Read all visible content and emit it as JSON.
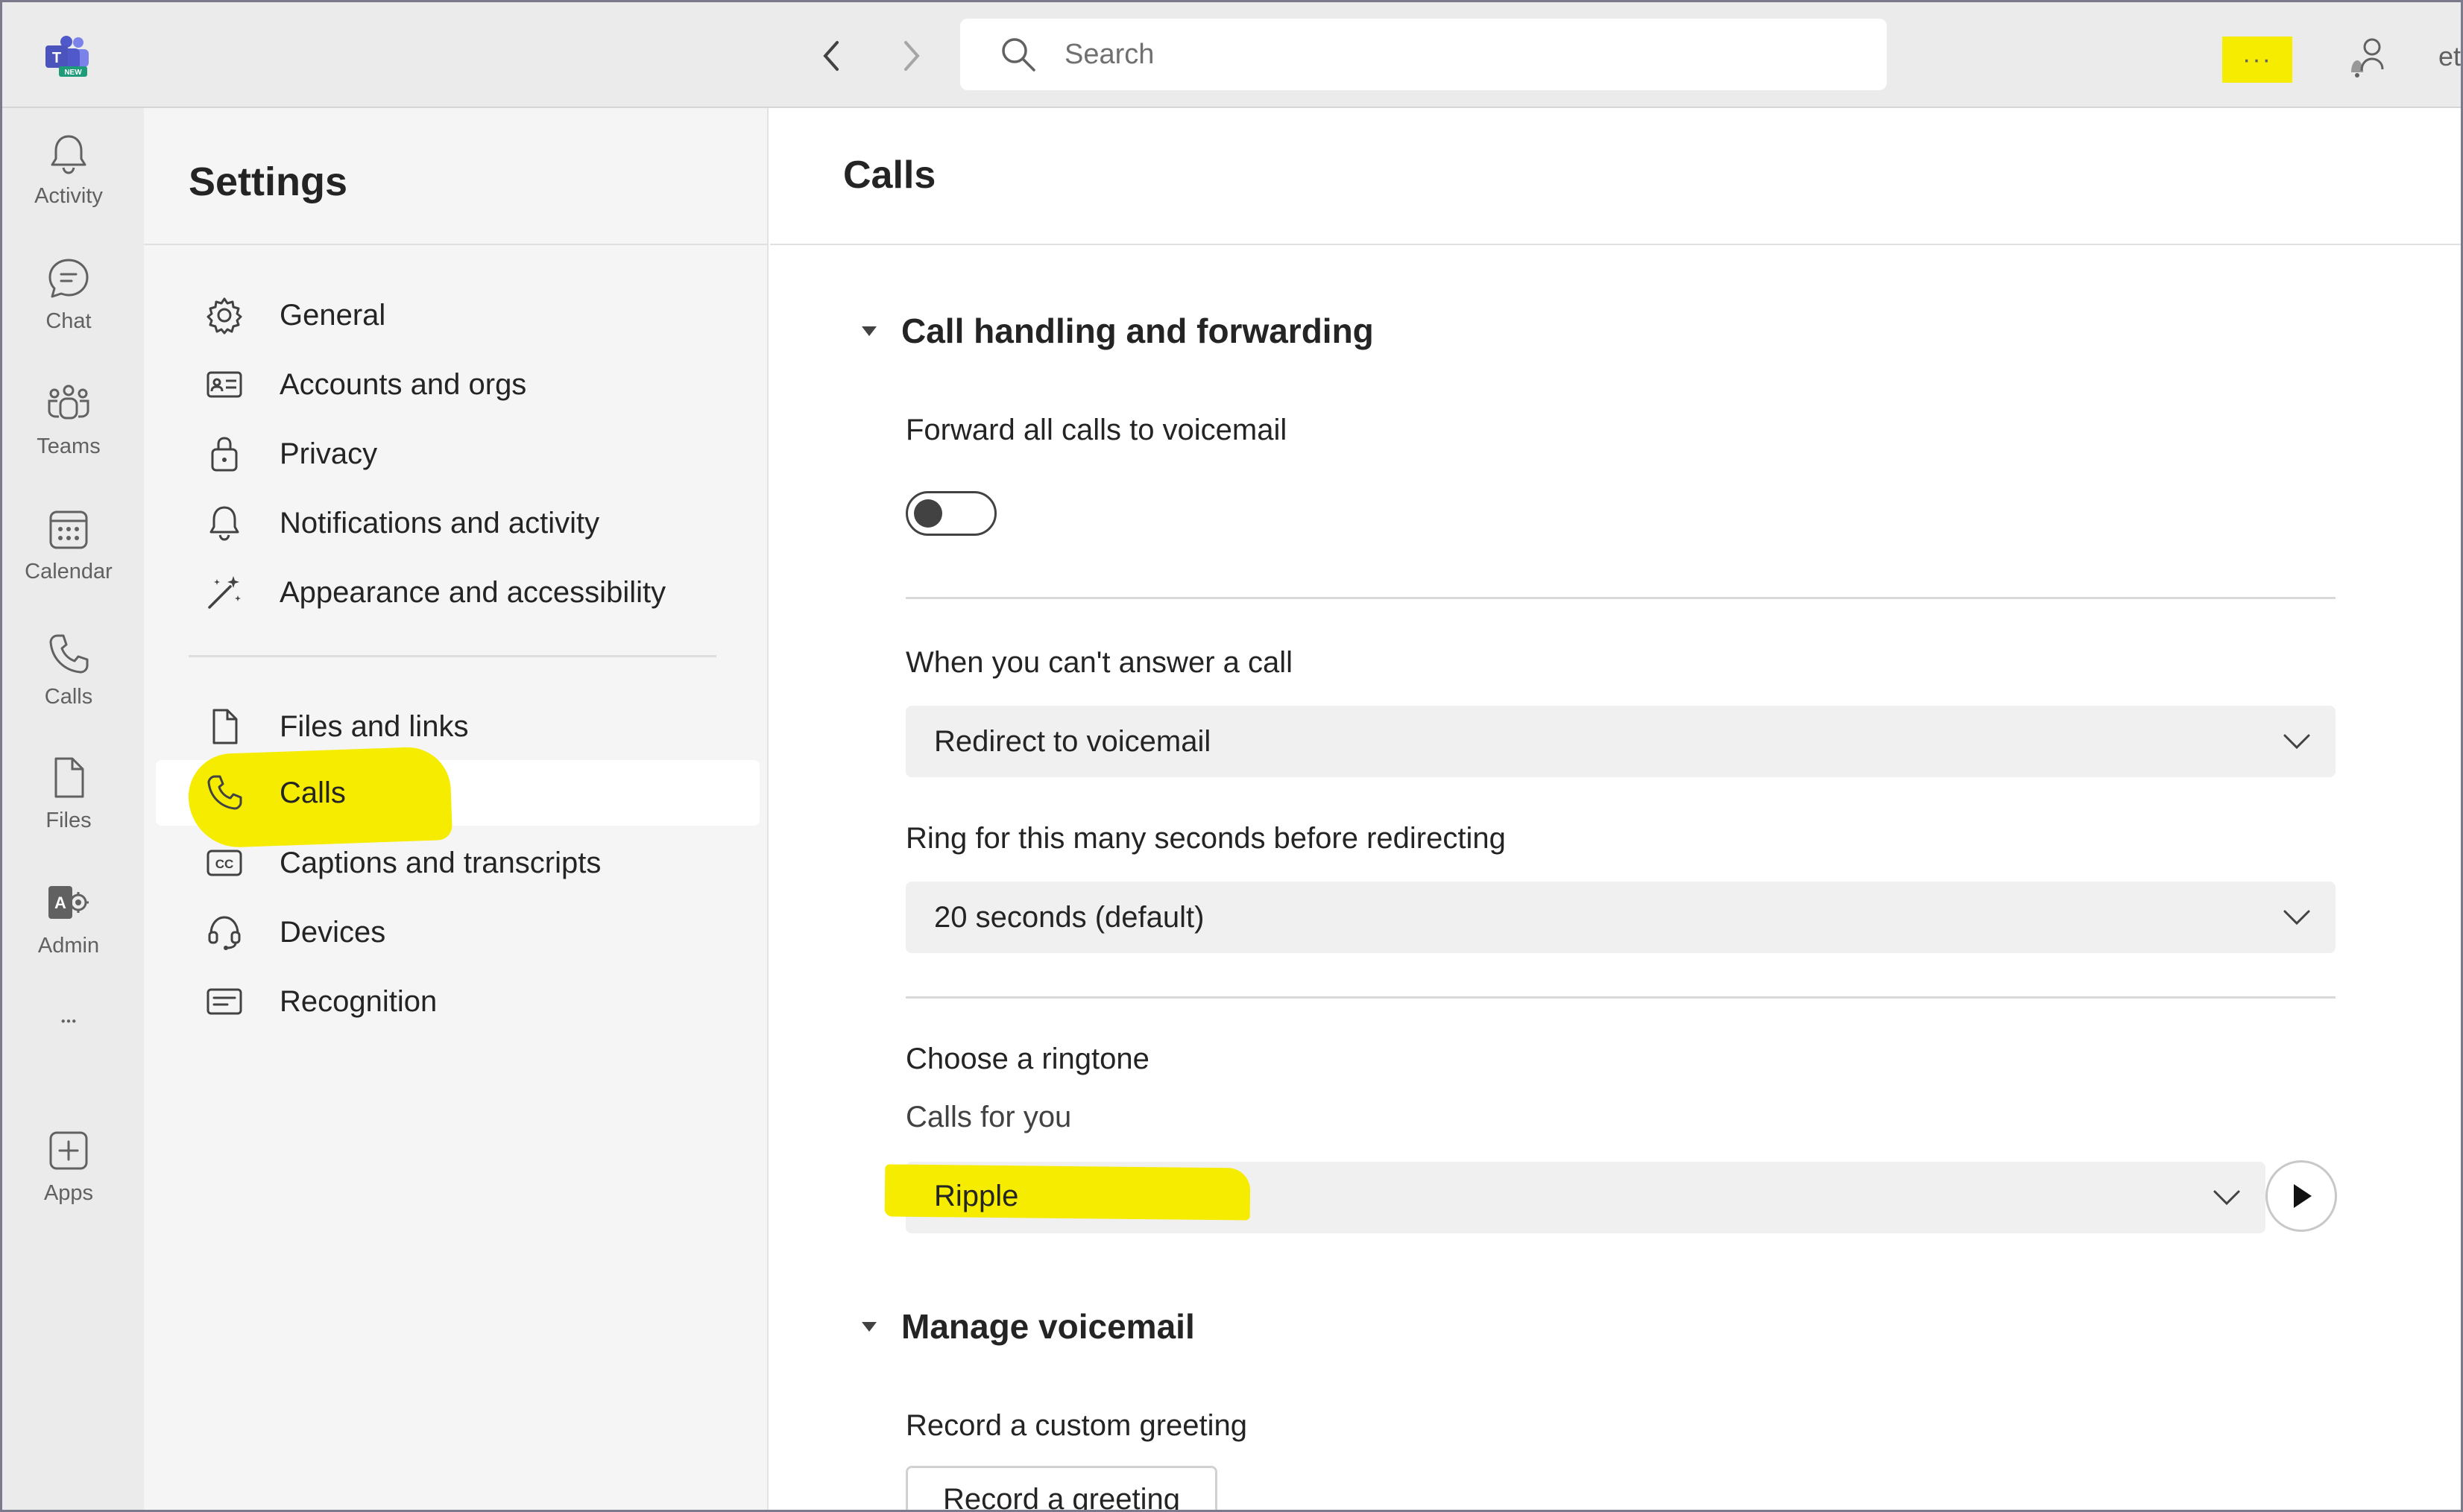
{
  "topbar": {
    "search_placeholder": "Search",
    "more_label": "···",
    "truncated_text": "et"
  },
  "rail": {
    "items": [
      {
        "label": "Activity",
        "icon": "bell-icon"
      },
      {
        "label": "Chat",
        "icon": "chat-icon"
      },
      {
        "label": "Teams",
        "icon": "teams-icon"
      },
      {
        "label": "Calendar",
        "icon": "calendar-icon"
      },
      {
        "label": "Calls",
        "icon": "phone-icon"
      },
      {
        "label": "Files",
        "icon": "file-icon"
      },
      {
        "label": "Admin",
        "icon": "admin-icon"
      },
      {
        "label": "",
        "icon": "more-icon"
      },
      {
        "label": "Apps",
        "icon": "add-app-icon"
      }
    ]
  },
  "sidebar": {
    "title": "Settings",
    "items": [
      {
        "label": "General",
        "icon": "gear-icon"
      },
      {
        "label": "Accounts and orgs",
        "icon": "id-card-icon"
      },
      {
        "label": "Privacy",
        "icon": "lock-icon"
      },
      {
        "label": "Notifications and activity",
        "icon": "bell-icon"
      },
      {
        "label": "Appearance and accessibility",
        "icon": "wand-icon"
      },
      {
        "label": "Files and links",
        "icon": "file-icon"
      },
      {
        "label": "Calls",
        "icon": "phone-icon",
        "selected": true
      },
      {
        "label": "Captions and transcripts",
        "icon": "cc-icon"
      },
      {
        "label": "Devices",
        "icon": "headset-icon"
      },
      {
        "label": "Recognition",
        "icon": "recognition-icon"
      }
    ]
  },
  "main": {
    "title": "Calls",
    "section_call_handling": "Call handling and forwarding",
    "forward_all_label": "Forward all calls to voicemail",
    "forward_all_on": false,
    "cant_answer_label": "When you can't answer a call",
    "cant_answer_value": "Redirect to voicemail",
    "ring_seconds_label": "Ring for this many seconds before redirecting",
    "ring_seconds_value": "20 seconds (default)",
    "ringtone_label": "Choose a ringtone",
    "calls_for_you_label": "Calls for you",
    "ringtone_value": "Ripple",
    "section_voicemail": "Manage voicemail",
    "record_greeting_label": "Record a custom greeting",
    "record_greeting_button": "Record a greeting"
  },
  "colors": {
    "highlight": "#f5ec00",
    "rail_bg": "#ebebeb",
    "sidebar_bg": "#f5f5f5",
    "accent": "#5b5fc7"
  }
}
